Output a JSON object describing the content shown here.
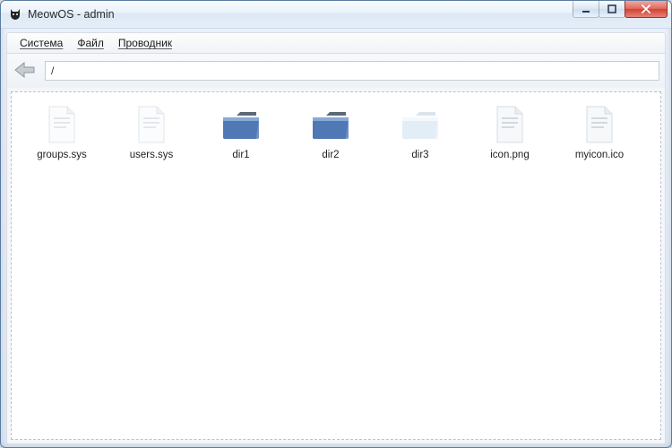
{
  "window": {
    "title": "MeowOS - admin"
  },
  "menu": {
    "items": [
      {
        "label": "Система"
      },
      {
        "label": "Файл"
      },
      {
        "label": "Проводник"
      }
    ]
  },
  "toolbar": {
    "path_value": "/"
  },
  "files": [
    {
      "name": "groups.sys",
      "icon": "file-generic"
    },
    {
      "name": "users.sys",
      "icon": "file-generic"
    },
    {
      "name": "dir1",
      "icon": "folder-blue"
    },
    {
      "name": "dir2",
      "icon": "folder-blue"
    },
    {
      "name": "dir3",
      "icon": "folder-light"
    },
    {
      "name": "icon.png",
      "icon": "file-generic"
    },
    {
      "name": "myicon.ico",
      "icon": "file-generic"
    }
  ],
  "icons": {
    "app": "cat-face-icon"
  }
}
